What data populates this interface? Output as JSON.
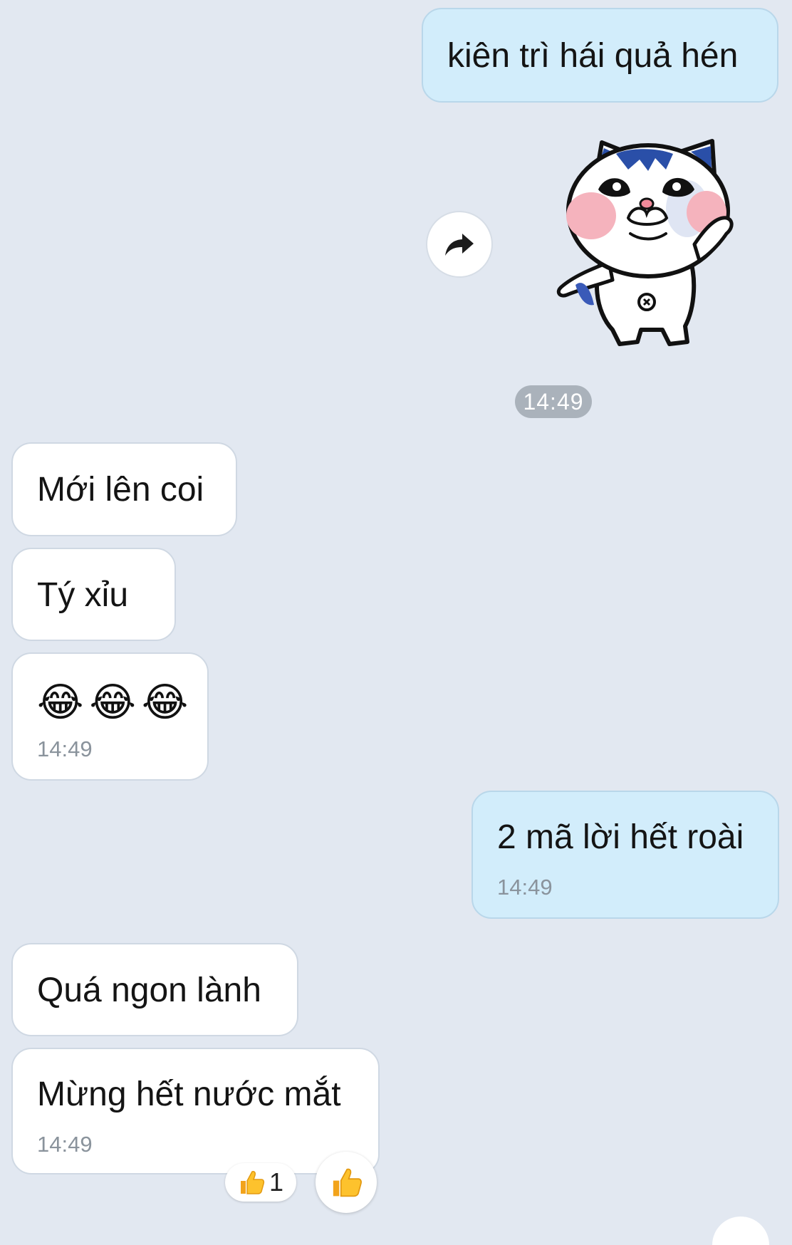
{
  "messages": [
    {
      "id": "m1",
      "direction": "outgoing",
      "text": "kiên trì hái quả hén"
    },
    {
      "id": "m2",
      "direction": "outgoing",
      "type": "sticker",
      "sticker": "white-cat-waving-sticker"
    },
    {
      "id": "m3",
      "direction": "incoming",
      "text": "Mới lên coi"
    },
    {
      "id": "m4",
      "direction": "incoming",
      "text": "Tý xỉu"
    },
    {
      "id": "m5",
      "direction": "incoming",
      "emoji": [
        "😂",
        "😂",
        "😂"
      ],
      "time": "14:49"
    },
    {
      "id": "m6",
      "direction": "outgoing",
      "text": "2 mã lời hết roài",
      "time": "14:49"
    },
    {
      "id": "m7",
      "direction": "incoming",
      "text": "Quá ngon lành"
    },
    {
      "id": "m8",
      "direction": "incoming",
      "text": "Mừng hết nước mắt",
      "time": "14:49"
    }
  ],
  "sticker_time": "14:49",
  "reaction": {
    "icon": "thumbs-up-icon",
    "count": "1"
  },
  "colors": {
    "background": "#e2e8f1",
    "incoming_bubble": "#ffffff",
    "outgoing_bubble": "#d2edfb",
    "time_pill": "#aab2bb",
    "timestamp": "#8a939c"
  }
}
